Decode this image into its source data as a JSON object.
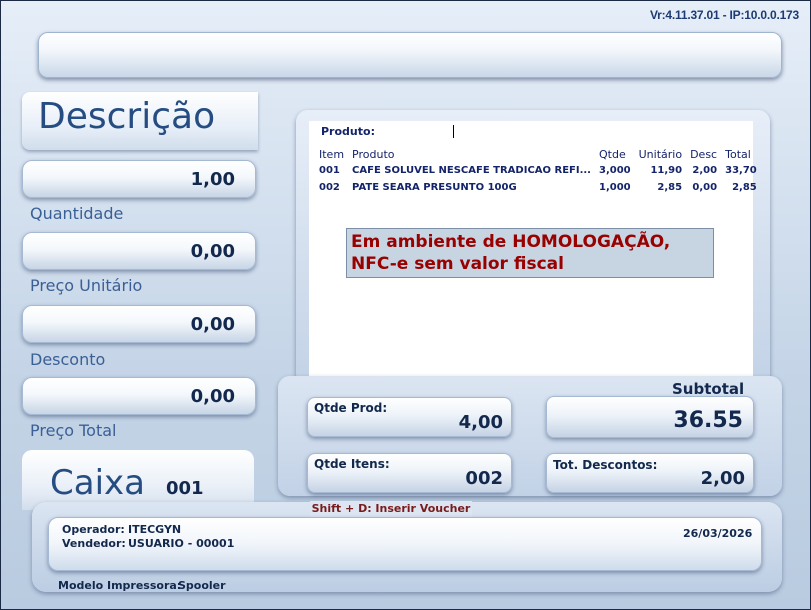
{
  "header": {
    "version": "Vr:4.11.37.01 - IP:10.0.0.173"
  },
  "left": {
    "title": "Descrição",
    "fields": [
      {
        "value": "1,00",
        "label": "Quantidade"
      },
      {
        "value": "0,00",
        "label": "Preço Unitário"
      },
      {
        "value": "0,00",
        "label": "Desconto"
      },
      {
        "value": "0,00",
        "label": "Preço Total"
      }
    ],
    "caixa_label": "Caixa",
    "caixa_number": "001"
  },
  "grid": {
    "produto_label": "Produto:",
    "columns": [
      "Item",
      "Produto",
      "Qtde",
      "Unitário",
      "Desc",
      "Total"
    ],
    "rows": [
      {
        "item": "001",
        "produto": "CAFE SOLUVEL NESCAFE TRADICAO REFI...",
        "qtde": "3,000",
        "unitario": "11,90",
        "desc": "2,00",
        "total": "33,70"
      },
      {
        "item": "002",
        "produto": "PATE SEARA PRESUNTO 100G",
        "qtde": "1,000",
        "unitario": "2,85",
        "desc": "0,00",
        "total": "2,85"
      }
    ]
  },
  "notice": {
    "line1": "Em ambiente de HOMOLOGAÇÃO,",
    "line2": "NFC-e sem valor fiscal"
  },
  "totals": {
    "qtde_prod_label": "Qtde Prod:",
    "qtde_prod": "4,00",
    "subtotal_label": "Subtotal",
    "subtotal": "36.55",
    "qtde_itens_label": "Qtde Itens:",
    "qtde_itens": "002",
    "tot_descontos_label": "Tot. Descontos:",
    "tot_descontos": "2,00"
  },
  "voucher_hint": "Shift + D: Inserir Voucher",
  "footer": {
    "operador_label": "Operador:",
    "operador": "ITECGYN",
    "vendedor_label": "Vendedor:",
    "vendedor": "USUARIO - 00001",
    "date": "26/03/2026",
    "impressora_label": "Modelo Impressora:",
    "impressora": "Spooler"
  }
}
